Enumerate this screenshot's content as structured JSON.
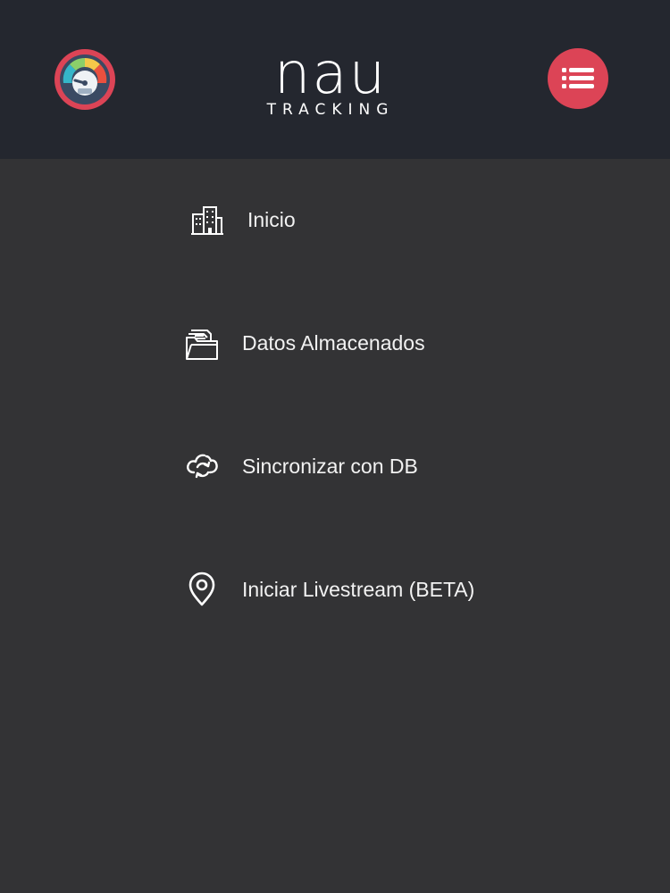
{
  "header": {
    "logo_word": "nau",
    "logo_subtitle": "TRACKING",
    "speed_button_icon": "speedometer-icon",
    "menu_button_icon": "list-icon",
    "background_color": "#24272f",
    "accent_color": "#dc4456"
  },
  "nav": {
    "items": [
      {
        "label": "Inicio",
        "icon": "buildings-icon"
      },
      {
        "label": "Datos Almacenados",
        "icon": "folder-files-icon"
      },
      {
        "label": "Sincronizar con DB",
        "icon": "cloud-sync-icon"
      },
      {
        "label": "Iniciar Livestream (BETA)",
        "icon": "location-pin-icon"
      }
    ]
  },
  "background_color": "#333335"
}
